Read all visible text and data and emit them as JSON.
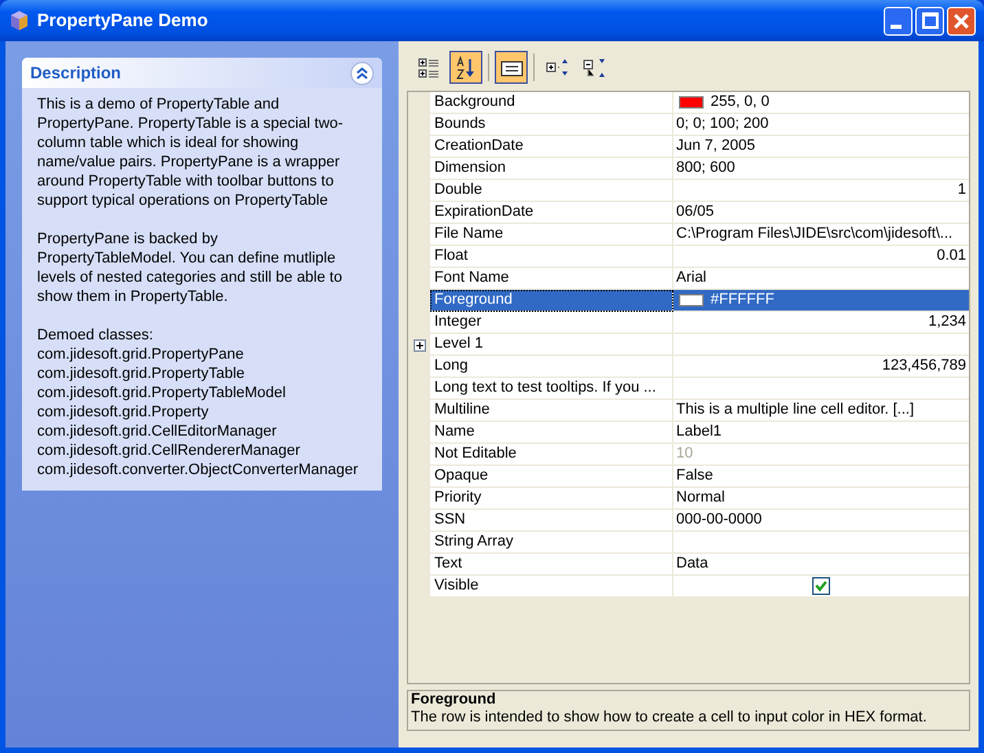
{
  "window": {
    "title": "PropertyPane Demo",
    "controls": [
      {
        "kind": "minimize"
      },
      {
        "kind": "maximize"
      },
      {
        "kind": "close"
      }
    ]
  },
  "description_panel": {
    "title": "Description",
    "expanded": true,
    "paragraphs": [
      "This is a demo of PropertyTable and PropertyPane. PropertyTable is a special two-column table which is ideal for showing name/value pairs. PropertyPane is a wrapper around PropertyTable with toolbar buttons to support typical operations on PropertyTable",
      "PropertyPane is backed by PropertyTableModel. You can define mutliple levels of nested categories and still be able to show them in PropertyTable."
    ],
    "classes_heading": "Demoed classes:",
    "classes": [
      "com.jidesoft.grid.PropertyPane",
      "com.jidesoft.grid.PropertyTable",
      "com.jidesoft.grid.PropertyTableModel",
      "com.jidesoft.grid.Property",
      "com.jidesoft.grid.CellEditorManager",
      "com.jidesoft.grid.CellRendererManager",
      "com.jidesoft.converter.ObjectConverterManager"
    ]
  },
  "toolbar": [
    {
      "kind": "categorized",
      "selected": false
    },
    {
      "kind": "alphabetic",
      "selected": true
    },
    {
      "kind": "description",
      "selected": true
    },
    {
      "kind": "expand_all",
      "selected": false
    },
    {
      "kind": "collapse_all",
      "selected": false
    }
  ],
  "properties": [
    {
      "name": "Background",
      "kind": "color",
      "value": "255, 0, 0",
      "color": "#ff0000",
      "selected": false
    },
    {
      "name": "Bounds",
      "kind": "text",
      "value": "0; 0; 100; 200",
      "selected": false
    },
    {
      "name": "CreationDate",
      "kind": "text",
      "value": "Jun 7, 2005",
      "selected": false
    },
    {
      "name": "Dimension",
      "kind": "text",
      "value": "800; 600",
      "selected": false
    },
    {
      "name": "Double",
      "kind": "number",
      "value": "1",
      "selected": false
    },
    {
      "name": "ExpirationDate",
      "kind": "text",
      "value": "06/05",
      "selected": false
    },
    {
      "name": "File Name",
      "kind": "text",
      "value": "C:\\Program Files\\JIDE\\src\\com\\jidesoft\\...",
      "selected": false
    },
    {
      "name": "Float",
      "kind": "number",
      "value": "0.01",
      "selected": false
    },
    {
      "name": "Font Name",
      "kind": "text",
      "value": "Arial",
      "selected": false
    },
    {
      "name": "Foreground",
      "kind": "color",
      "value": "#FFFFFF",
      "color": "#ffffff",
      "selected": true
    },
    {
      "name": "Integer",
      "kind": "number",
      "value": "1,234",
      "selected": false
    },
    {
      "name": "Level 1",
      "kind": "category",
      "expanded": false,
      "selected": false
    },
    {
      "name": "Long",
      "kind": "number",
      "value": "123,456,789",
      "selected": false
    },
    {
      "name": "Long text to test tooltips. If you ...",
      "kind": "empty",
      "selected": false
    },
    {
      "name": "Multiline",
      "kind": "text",
      "value": "This is a multiple line cell editor.  [...]",
      "selected": false
    },
    {
      "name": "Name",
      "kind": "text",
      "value": "Label1",
      "selected": false
    },
    {
      "name": "Not Editable",
      "kind": "readonly",
      "value": "10",
      "selected": false
    },
    {
      "name": "Opaque",
      "kind": "text",
      "value": "False",
      "selected": false
    },
    {
      "name": "Priority",
      "kind": "text",
      "value": "Normal",
      "selected": false
    },
    {
      "name": "SSN",
      "kind": "text",
      "value": "000-00-0000",
      "selected": false
    },
    {
      "name": "String Array",
      "kind": "empty",
      "selected": false
    },
    {
      "name": "Text",
      "kind": "text",
      "value": "Data",
      "selected": false
    },
    {
      "name": "Visible",
      "kind": "checkbox",
      "checked": true,
      "selected": false
    }
  ],
  "description_bar": {
    "title": "Foreground",
    "text": "The row is intended to show how to create a cell to input color in HEX format."
  }
}
